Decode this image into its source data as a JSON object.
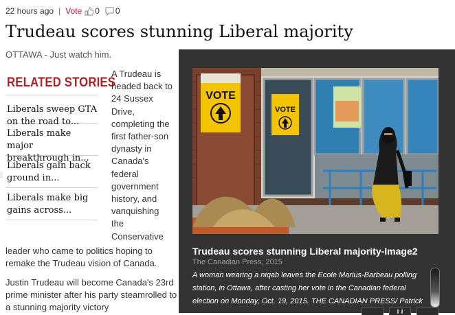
{
  "meta": {
    "time": "22 hours ago",
    "separator": "|",
    "vote_label": "Vote",
    "thumbs_up_count": "0",
    "comment_count": "0"
  },
  "article": {
    "headline": "Trudeau scores stunning Liberal majority",
    "dateline": "OTTAWA - Just watch him.",
    "para1_column": "A Trudeau is headed back to 24 Sussex Drive, completing the first father-son dynasty in Canada's federal government history, and vanquishing the Conservative",
    "para1_full": "leader who came to politics hoping to remake the Trudeau vision of Canada.",
    "para2": "Justin Trudeau will become Canada's 23rd prime minister after his party steamrolled to a stunning majority victory"
  },
  "related": {
    "title": "RELATED STORIES",
    "items": [
      {
        "label": "Liberals sweep GTA on the road to..."
      },
      {
        "label": "Liberals make major breakthrough in..."
      },
      {
        "label": "Liberals gain back ground in..."
      },
      {
        "label": "Liberals make big gains across..."
      }
    ]
  },
  "gallery": {
    "photo_signs": [
      "VOTE",
      "VOTE"
    ],
    "caption_title": "Trudeau scores stunning Liberal majority-Image2",
    "credit": "The Canadian Press, 2015",
    "caption": "A woman wearing a niqab leaves the Ecole Marius-Barbeau polling station, in Ottawa, after casting her vote in the Canadian federal election on Monday, Oct. 19, 2015. THE CANADIAN PRESS/ Patrick"
  },
  "icons": [
    "thumbs-up-icon",
    "comment-icon",
    "pause-icon"
  ],
  "colors": {
    "vote": "#c8102e",
    "related_title": "#b51f24",
    "gallery_bg": "#333333"
  }
}
